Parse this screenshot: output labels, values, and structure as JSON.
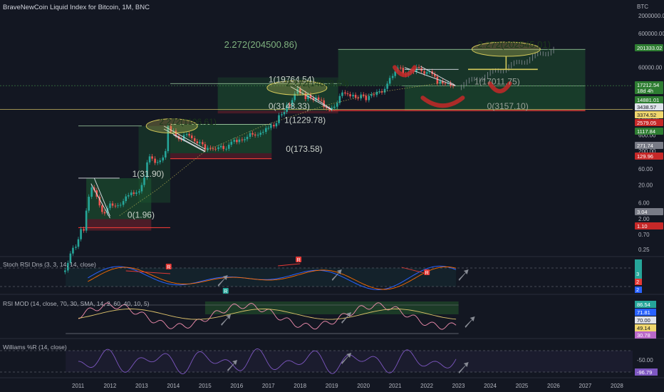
{
  "chart_title": "BraveNewCoin Liquid Index for Bitcoin, 1M, BNC",
  "currency_label": "BTC",
  "colors": {
    "background": "#131722",
    "up_candle": "#26a69a",
    "down_candle": "#ef5350",
    "projection": "#8a8f99",
    "fib_zone": "#1e5b32",
    "fib_zone_light": "#2e7d32",
    "fib_loss": "#5b1e2a",
    "fib_line": "#a5d6a7",
    "highlight": "#d4c95a",
    "stoch_k": "#2962ff",
    "stoch_d": "#ff6d00",
    "rsi_line": "#f48fb1",
    "rsi_ma": "#e0c46c",
    "willr_line": "#7e57c2",
    "arrow": "#9598a1",
    "accent_red": "#c62828"
  },
  "chart_data": [
    {
      "name": "price",
      "type": "candlestick",
      "title": "BraveNewCoin Liquid Index for Bitcoin, 1M, BNC",
      "y_scale": "log",
      "x_ticks": [
        "2011",
        "2012",
        "2013",
        "2014",
        "2015",
        "2016",
        "2017",
        "2018",
        "2019",
        "2020",
        "2021",
        "2022",
        "2023",
        "2024",
        "2025",
        "2026",
        "2027",
        "2028"
      ],
      "y_ticks": [
        2000000,
        600000,
        60000,
        20000,
        6000,
        2000,
        600,
        200,
        60,
        20,
        6,
        2,
        0.7,
        0.25
      ],
      "y_tick_labels": [
        "2000000.00",
        "600000.00",
        "60000.00",
        "20000.00",
        "6000.00",
        "2000.00",
        "600.00",
        "200.00",
        "60.00",
        "20.00",
        "6.00",
        "2.00",
        "0.70",
        "0.25"
      ],
      "candles_t": [
        2010.58,
        2010.67,
        2010.75,
        2010.83,
        2010.92,
        2011.0,
        2011.08,
        2011.17,
        2011.25,
        2011.33,
        2011.42,
        2011.5,
        2011.58,
        2011.67,
        2011.75,
        2011.83,
        2011.92,
        2012.0,
        2012.08,
        2012.17,
        2012.25,
        2012.33,
        2012.42,
        2012.5,
        2012.58,
        2012.67,
        2012.75,
        2012.83,
        2012.92,
        2013.0,
        2013.08,
        2013.17,
        2013.25,
        2013.33,
        2013.42,
        2013.5,
        2013.58,
        2013.67,
        2013.75,
        2013.83,
        2013.92,
        2014.0,
        2014.08,
        2014.17,
        2014.25,
        2014.33,
        2014.42,
        2014.5,
        2014.58,
        2014.67,
        2014.75,
        2014.83,
        2014.92,
        2015.0,
        2015.08,
        2015.17,
        2015.25,
        2015.33,
        2015.42,
        2015.5,
        2015.58,
        2015.67,
        2015.75,
        2015.83,
        2015.92,
        2016.0,
        2016.08,
        2016.17,
        2016.25,
        2016.33,
        2016.42,
        2016.5,
        2016.58,
        2016.67,
        2016.75,
        2016.83,
        2016.92,
        2017.0,
        2017.08,
        2017.17,
        2017.25,
        2017.33,
        2017.42,
        2017.5,
        2017.58,
        2017.67,
        2017.75,
        2017.83,
        2017.92,
        2018.0,
        2018.08,
        2018.17,
        2018.25,
        2018.33,
        2018.42,
        2018.5,
        2018.58,
        2018.67,
        2018.75,
        2018.83,
        2018.92,
        2019.0,
        2019.08,
        2019.17,
        2019.25,
        2019.33,
        2019.42,
        2019.5,
        2019.58,
        2019.67,
        2019.75,
        2019.83,
        2019.92,
        2020.0,
        2020.08,
        2020.17,
        2020.25,
        2020.33,
        2020.42,
        2020.5,
        2020.58,
        2020.67,
        2020.75,
        2020.83,
        2020.92,
        2021.0,
        2021.08,
        2021.17,
        2021.25,
        2021.33,
        2021.42,
        2021.5,
        2021.58,
        2021.67,
        2021.75,
        2021.83,
        2021.92,
        2022.0,
        2022.08,
        2022.17,
        2022.25,
        2022.33,
        2022.42,
        2022.5,
        2022.58,
        2022.67,
        2022.75,
        2022.83,
        2022.92
      ],
      "candles_close": [
        0.06,
        0.1,
        0.19,
        0.28,
        0.3,
        0.5,
        1.0,
        0.9,
        3.5,
        9,
        17,
        14,
        9,
        5,
        3.2,
        2.9,
        4.2,
        5.7,
        4.9,
        4.8,
        5.0,
        5.2,
        6.7,
        9.2,
        10,
        12,
        11,
        12,
        13,
        20,
        33,
        93,
        140,
        120,
        90,
        95,
        106,
        130,
        200,
        1100,
        750,
        800,
        560,
        450,
        440,
        600,
        640,
        580,
        480,
        390,
        340,
        370,
        320,
        220,
        250,
        240,
        235,
        230,
        260,
        285,
        230,
        235,
        310,
        380,
        430,
        370,
        440,
        420,
        450,
        530,
        680,
        620,
        580,
        610,
        700,
        740,
        960,
        970,
        1190,
        1080,
        1340,
        2300,
        2450,
        2880,
        4700,
        4380,
        6450,
        9950,
        13800,
        10200,
        10300,
        6900,
        9200,
        7500,
        6400,
        7700,
        6600,
        6300,
        4000,
        3700,
        3450,
        3800,
        4100,
        5300,
        8500,
        10800,
        10100,
        9600,
        8300,
        9200,
        7600,
        7200,
        9400,
        8600,
        6400,
        8600,
        9500,
        9100,
        11300,
        11700,
        10800,
        13800,
        19700,
        29000,
        33100,
        45200,
        58700,
        57700,
        37300,
        35000,
        41500,
        47100,
        43800,
        61300,
        57000,
        46200,
        38500,
        43200,
        45500,
        37700,
        31800,
        19800,
        23300,
        20000,
        19400,
        20500,
        17200,
        16500
      ]
    },
    {
      "name": "stoch_rsi",
      "label": "Stoch RSI Dns (3, 3, 14, 14, close)",
      "type": "line",
      "y_range": [
        0,
        100
      ],
      "badge_values": [
        "3",
        "2",
        "2"
      ],
      "signal_markers": [
        "R",
        "R",
        "R",
        "R",
        "R"
      ]
    },
    {
      "name": "rsi_mod",
      "label": "RSI MOD (14, close, 70, 30, SMA, 14, 2, 60, 40, 10, 5)",
      "type": "line",
      "y_range": [
        0,
        100
      ],
      "badge_values": [
        "86.54",
        "71.81",
        "70.00",
        "49.14",
        "30.78"
      ]
    },
    {
      "name": "williams_r",
      "label": "Williams %R (14, close)",
      "type": "line",
      "y_range": [
        -100,
        0
      ],
      "y_ticks": [
        "-50.00"
      ],
      "badge_values": [
        "-96.79"
      ]
    }
  ],
  "fib_labels": [
    {
      "text": "2.272(204500.86)"
    },
    {
      "text": "2.272(202545.01)"
    },
    {
      "text": "1(19764.54)"
    },
    {
      "text": "2.272(14839.93)"
    },
    {
      "text": "0(3148.33)"
    },
    {
      "text": "1(1229.78)"
    },
    {
      "text": "2.272(1106.61)"
    },
    {
      "text": "0(173.58)"
    },
    {
      "text": "1(31.90)"
    },
    {
      "text": "0(1.96)"
    },
    {
      "text": "1(17011.75)"
    },
    {
      "text": "0(3157.10)"
    }
  ],
  "price_badges": [
    {
      "text": "201333.02",
      "color": "#2e7d32"
    },
    {
      "text": "17212.54",
      "color": "#2e7d32"
    },
    {
      "text": "18d 4h",
      "color": "#2e7d32"
    },
    {
      "text": "14881.01",
      "color": "#2e7d32"
    },
    {
      "text": "3438.57",
      "color": "#e0e3eb"
    },
    {
      "text": "3374.52",
      "color": "#f0d76e"
    },
    {
      "text": "2579.05",
      "color": "#c62828"
    },
    {
      "text": "1117.84",
      "color": "#2e7d32"
    },
    {
      "text": "271.74",
      "color": "#787b86"
    },
    {
      "text": "129.96",
      "color": "#c62828"
    },
    {
      "text": "3.04",
      "color": "#787b86"
    },
    {
      "text": "1.10",
      "color": "#c62828"
    }
  ]
}
